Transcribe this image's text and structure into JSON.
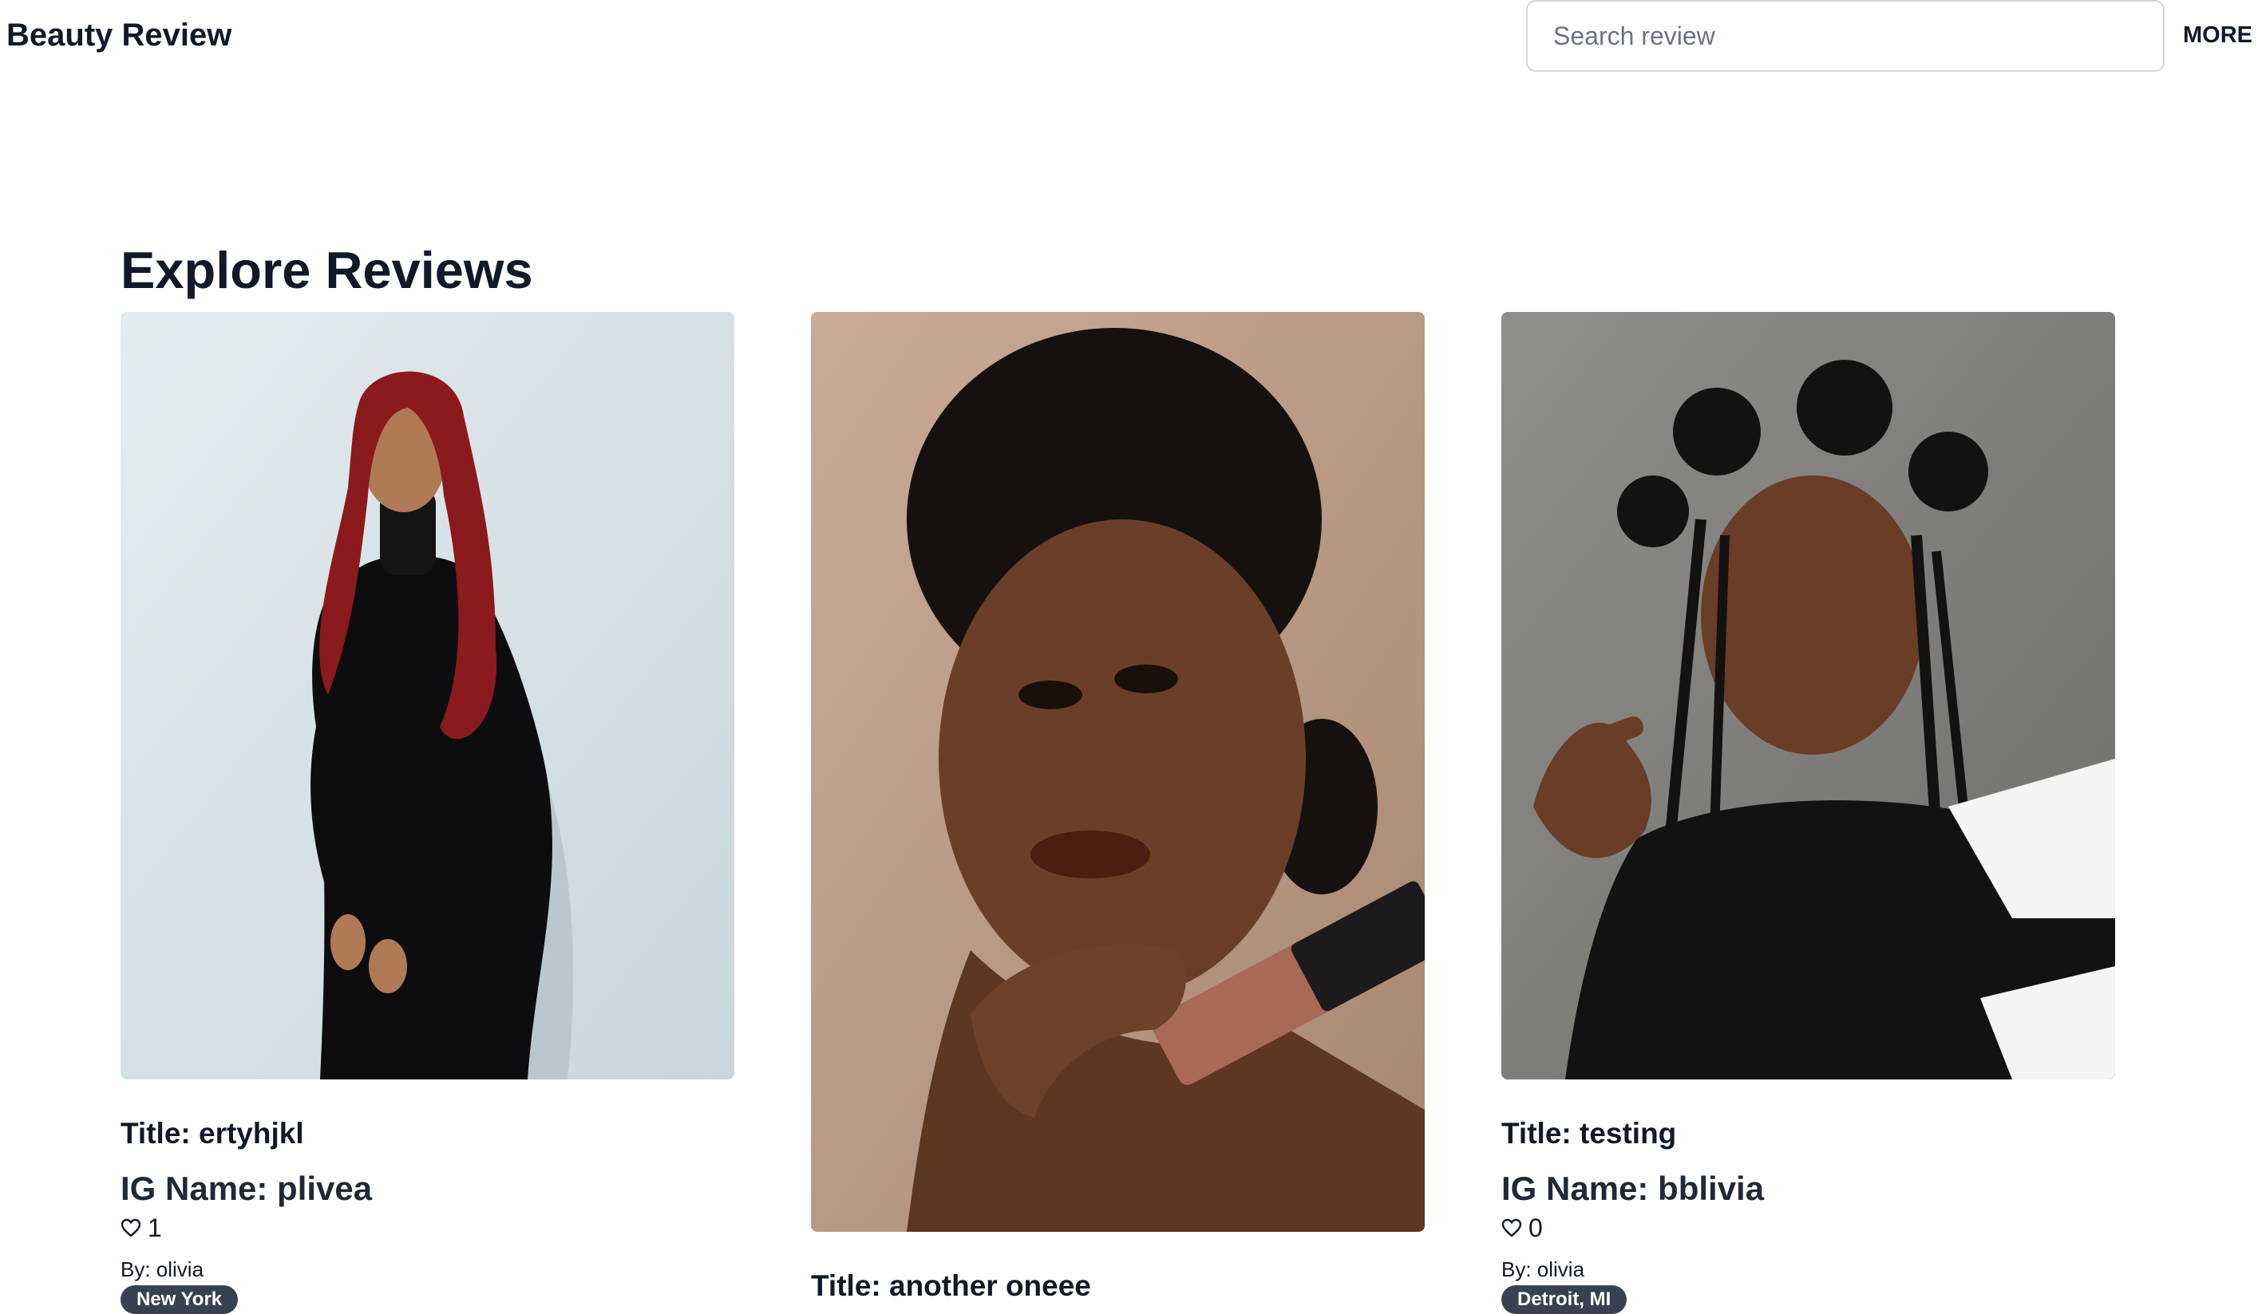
{
  "header": {
    "brand": "Beauty Review",
    "search_placeholder": "Search review",
    "search_value": "",
    "more_label": "MORE"
  },
  "main": {
    "title": "Explore Reviews",
    "cards": [
      {
        "image_alt": "woman with long red hair in a black dress",
        "title": "Title: ertyhjkl",
        "ig_name": "IG Name: plivea",
        "likes": "1",
        "author": "By: olivia",
        "location": "New York"
      },
      {
        "image_alt": "woman holding a cosmetic tube",
        "title": "Title: another oneee"
      },
      {
        "image_alt": "woman with braided hair in a black and white top",
        "title": "Title: testing",
        "ig_name": "IG Name: bblivia",
        "likes": "0",
        "author": "By: olivia",
        "location": "Detroit, MI"
      }
    ]
  },
  "icons": {
    "like": "heart-outline-icon"
  }
}
